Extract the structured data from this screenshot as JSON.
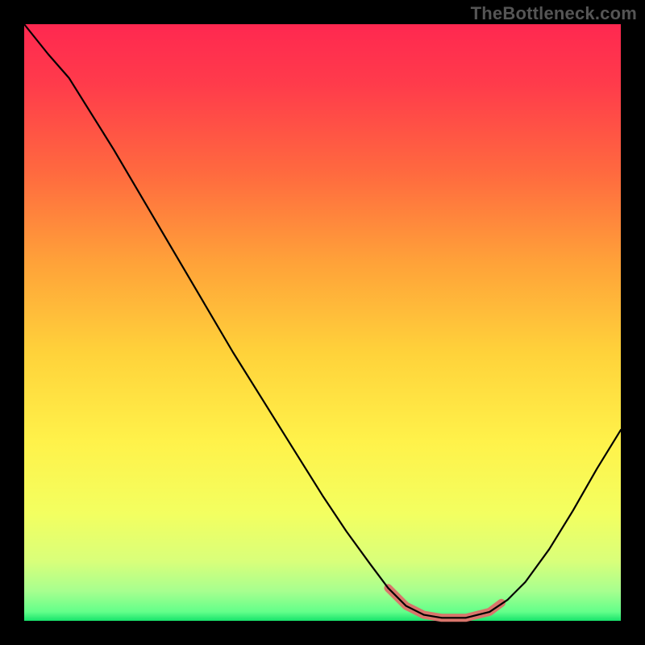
{
  "watermark": "TheBottleneck.com",
  "chart_data": {
    "type": "line",
    "title": "",
    "xlabel": "",
    "ylabel": "",
    "xlim": [
      0,
      1
    ],
    "ylim": [
      0,
      1
    ],
    "gradient_stops": [
      {
        "offset": 0.0,
        "color": "#ff2850"
      },
      {
        "offset": 0.1,
        "color": "#ff3b4b"
      },
      {
        "offset": 0.25,
        "color": "#ff6a3f"
      },
      {
        "offset": 0.4,
        "color": "#ffa239"
      },
      {
        "offset": 0.55,
        "color": "#ffd23a"
      },
      {
        "offset": 0.7,
        "color": "#fff24a"
      },
      {
        "offset": 0.82,
        "color": "#f3ff60"
      },
      {
        "offset": 0.9,
        "color": "#d9ff7a"
      },
      {
        "offset": 0.95,
        "color": "#a7ff8f"
      },
      {
        "offset": 0.985,
        "color": "#63ff8a"
      },
      {
        "offset": 1.0,
        "color": "#17e36b"
      }
    ],
    "series": [
      {
        "name": "curve-black",
        "stroke": "#000000",
        "stroke_width": 2.2,
        "points": [
          {
            "x": 0.0,
            "y": 1.0
          },
          {
            "x": 0.04,
            "y": 0.95
          },
          {
            "x": 0.075,
            "y": 0.91
          },
          {
            "x": 0.1,
            "y": 0.87
          },
          {
            "x": 0.15,
            "y": 0.79
          },
          {
            "x": 0.2,
            "y": 0.705
          },
          {
            "x": 0.25,
            "y": 0.62
          },
          {
            "x": 0.3,
            "y": 0.535
          },
          {
            "x": 0.35,
            "y": 0.45
          },
          {
            "x": 0.4,
            "y": 0.37
          },
          {
            "x": 0.45,
            "y": 0.29
          },
          {
            "x": 0.5,
            "y": 0.21
          },
          {
            "x": 0.54,
            "y": 0.15
          },
          {
            "x": 0.58,
            "y": 0.095
          },
          {
            "x": 0.61,
            "y": 0.055
          },
          {
            "x": 0.64,
            "y": 0.025
          },
          {
            "x": 0.67,
            "y": 0.01
          },
          {
            "x": 0.7,
            "y": 0.005
          },
          {
            "x": 0.74,
            "y": 0.005
          },
          {
            "x": 0.78,
            "y": 0.015
          },
          {
            "x": 0.81,
            "y": 0.035
          },
          {
            "x": 0.84,
            "y": 0.065
          },
          {
            "x": 0.88,
            "y": 0.12
          },
          {
            "x": 0.92,
            "y": 0.185
          },
          {
            "x": 0.96,
            "y": 0.255
          },
          {
            "x": 1.0,
            "y": 0.32
          }
        ]
      },
      {
        "name": "trough-highlight",
        "stroke": "#d8756b",
        "stroke_width": 10,
        "points": [
          {
            "x": 0.61,
            "y": 0.055
          },
          {
            "x": 0.64,
            "y": 0.025
          },
          {
            "x": 0.67,
            "y": 0.01
          },
          {
            "x": 0.7,
            "y": 0.005
          },
          {
            "x": 0.74,
            "y": 0.005
          },
          {
            "x": 0.78,
            "y": 0.015
          },
          {
            "x": 0.8,
            "y": 0.03
          }
        ]
      }
    ]
  }
}
